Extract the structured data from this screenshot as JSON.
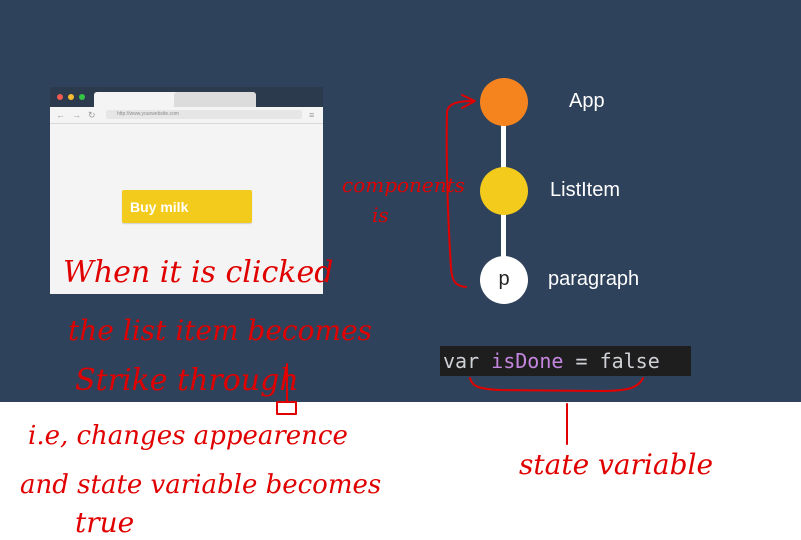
{
  "browser": {
    "url": "http://www.yourwebsite.com",
    "button_label": "Buy milk",
    "colors": {
      "button": "#f2cb1d"
    }
  },
  "tree": {
    "nodes": [
      {
        "label": "App",
        "color": "#f5841f"
      },
      {
        "label": "ListItem",
        "color": "#f2cb1d"
      },
      {
        "label": "paragraph",
        "letter": "p",
        "color": "#ffffff"
      }
    ]
  },
  "code": {
    "keyword": "var",
    "name": "isDone",
    "operator": "=",
    "value": "false",
    "colors": {
      "name": "#c586e0"
    }
  },
  "annotations": {
    "color": "#e00000",
    "components": [
      "components",
      "is"
    ],
    "clicked": "When it is clicked",
    "list_item": "the list item becomes",
    "strike": "Strike through",
    "appearance": "i.e, changes appearence",
    "state": "and state variable becomes",
    "true": "true",
    "state_variable": "state variable"
  }
}
